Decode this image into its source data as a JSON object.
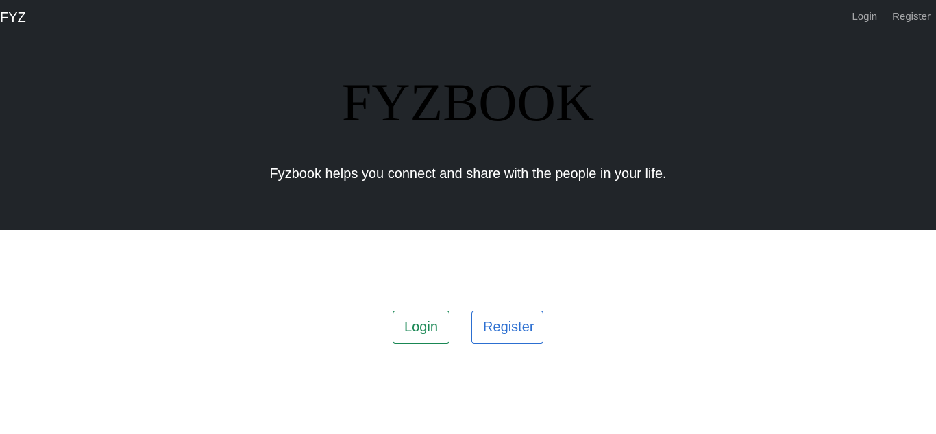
{
  "navbar": {
    "brand": "FYZ",
    "links": [
      {
        "label": "Login"
      },
      {
        "label": "Register"
      }
    ]
  },
  "hero": {
    "title": "FYZBOOK",
    "tagline": "Fyzbook helps you connect and share with the people in your life."
  },
  "actions": {
    "login_label": "Login",
    "register_label": "Register"
  },
  "colors": {
    "hero_background": "#212529",
    "login_button": "#198754",
    "register_button": "#2c6fd1"
  }
}
